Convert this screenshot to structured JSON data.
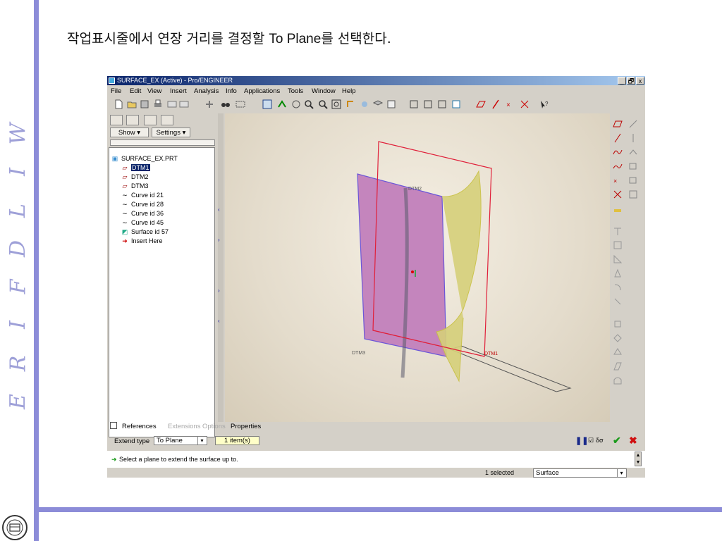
{
  "slide": {
    "caption_ko": "작업표시줄에서 연장 거리를 결정할 ",
    "caption_en": "To Plane",
    "caption_tail": "를 선택한다.",
    "brand_letters": [
      "W",
      "I",
      "L",
      "D",
      "F",
      "I",
      "R",
      "E"
    ],
    "accent_color": "#8c8cd8"
  },
  "window": {
    "title": "SURFACE_EX (Active) - Pro/ENGINEER",
    "buttons": [
      "_",
      "🗗",
      "x"
    ]
  },
  "menu": [
    "File",
    "Edit",
    "View",
    "Insert",
    "Analysis",
    "Info",
    "Applications",
    "Tools",
    "Window",
    "Help"
  ],
  "tree": {
    "show_label": "Show ▾",
    "settings_label": "Settings ▾",
    "root": "SURFACE_EX.PRT",
    "items": [
      {
        "label": "DTM1",
        "icon": "datum-plane-icon",
        "selected": true
      },
      {
        "label": "DTM2",
        "icon": "datum-plane-icon",
        "selected": false
      },
      {
        "label": "DTM3",
        "icon": "datum-plane-icon",
        "selected": false
      },
      {
        "label": "Curve id 21",
        "icon": "curve-icon",
        "selected": false
      },
      {
        "label": "Curve id 28",
        "icon": "curve-icon",
        "selected": false
      },
      {
        "label": "Curve id 36",
        "icon": "curve-icon",
        "selected": false
      },
      {
        "label": "Curve id 45",
        "icon": "curve-icon",
        "selected": false
      },
      {
        "label": "Surface id 57",
        "icon": "surface-icon",
        "selected": false
      },
      {
        "label": "Insert Here",
        "icon": "insert-arrow-icon",
        "selected": false
      }
    ]
  },
  "model": {
    "labels": {
      "dtm1": "DTM1",
      "dtm2": "DTM2",
      "dtm3": "DTM3"
    }
  },
  "dashboard": {
    "tabs": {
      "references": "References",
      "extensions": "Extensions",
      "options": "Options",
      "properties": "Properties"
    },
    "extend_type_label": "Extend type",
    "extend_type_value": "To Plane",
    "items_value": "1 item(s)",
    "message": "Select a plane to extend the surface up to.",
    "selected_count": "1 selected",
    "filter_value": "Surface"
  }
}
